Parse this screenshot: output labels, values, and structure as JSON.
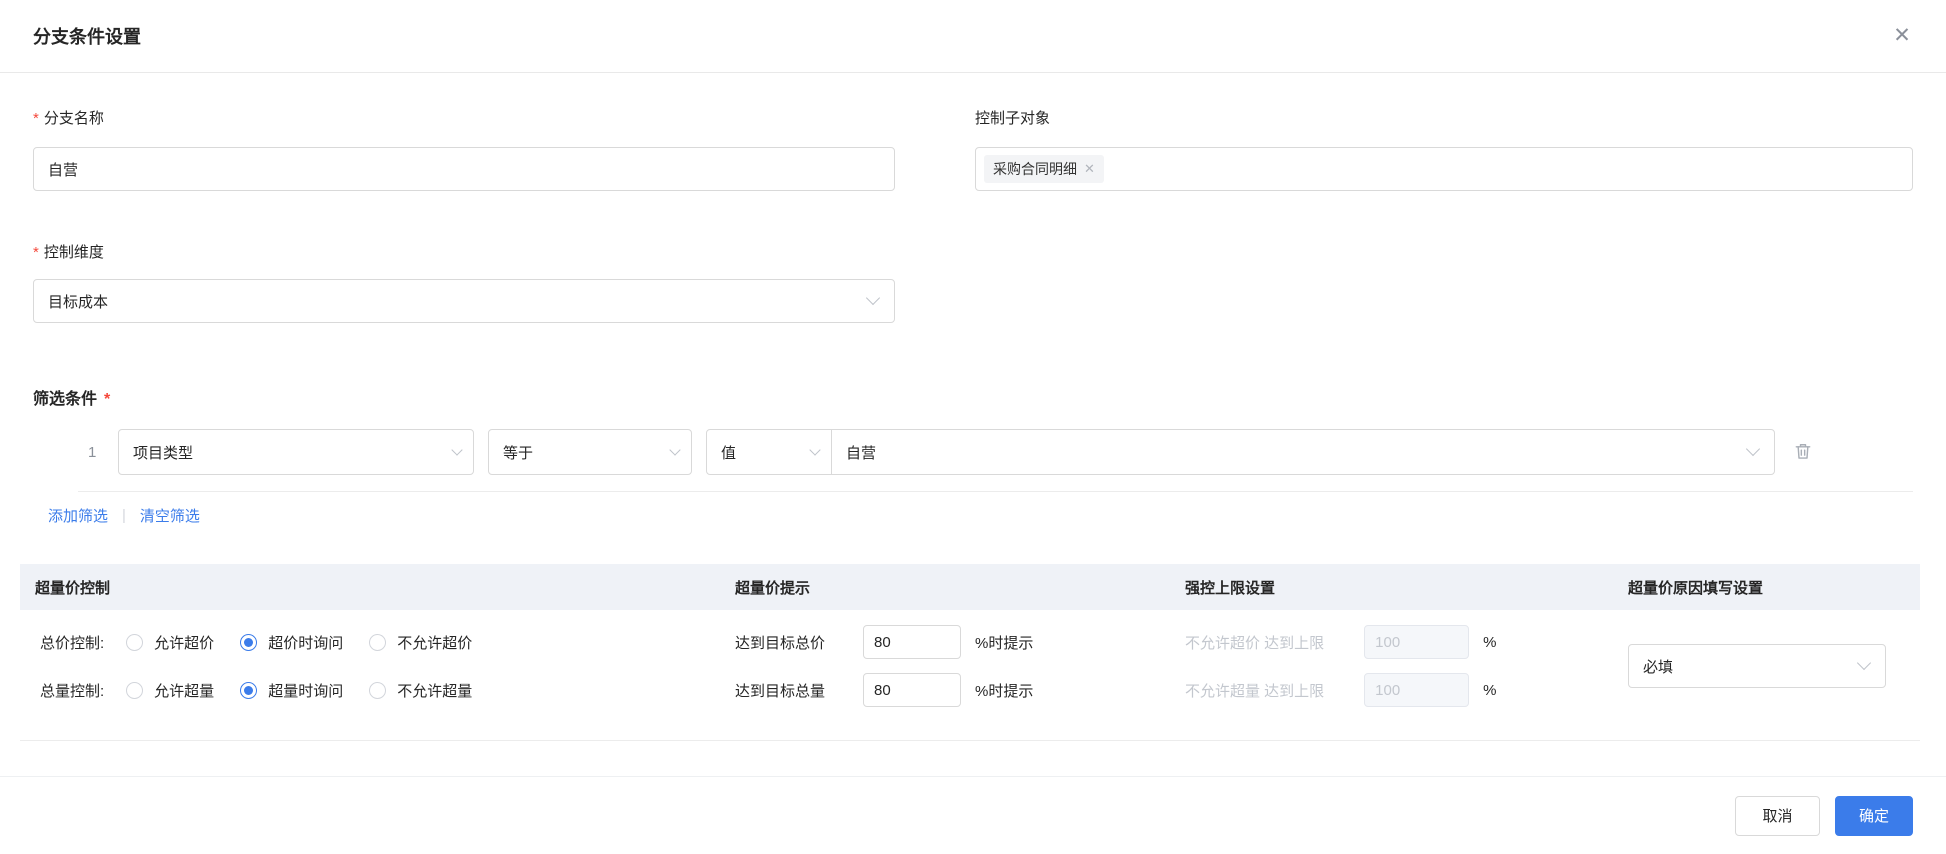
{
  "colors": {
    "primary": "#3B7CEA",
    "required_mark": "#F5483B",
    "table_header_bg": "#EFF2F7",
    "disabled_text": "#C3C7CE",
    "link": "#3B7CEA"
  },
  "dialog": {
    "title": "分支条件设置",
    "close_glyph": "✕"
  },
  "form": {
    "branch_name": {
      "required_mark": "*",
      "label": "分支名称",
      "value": "自营"
    },
    "control_sub_object": {
      "label": "控制子对象",
      "tag": "采购合同明细",
      "tag_remove_glyph": "✕"
    },
    "control_dimension": {
      "required_mark": "*",
      "label": "控制维度",
      "value": "目标成本"
    }
  },
  "filter": {
    "title": "筛选条件",
    "required_mark": "*",
    "rows": [
      {
        "index": "1",
        "field": "项目类型",
        "operator": "等于",
        "value_type": "值",
        "value": "自营"
      }
    ],
    "add_label": "添加筛选",
    "separator": "|",
    "clear_label": "清空筛选"
  },
  "control_table": {
    "headers": [
      "超量价控制",
      "超量价提示",
      "强控上限设置",
      "超量价原因填写设置"
    ],
    "rows": [
      {
        "label": "总价控制:",
        "radios": [
          {
            "label": "允许超价",
            "checked": false
          },
          {
            "label": "超价时询问",
            "checked": true
          },
          {
            "label": "不允许超价",
            "checked": false
          }
        ],
        "prompt_prefix": "达到目标总价",
        "prompt_value": "80",
        "prompt_suffix": "%时提示",
        "limit_label": "不允许超价 达到上限",
        "limit_value": "100",
        "limit_unit": "%"
      },
      {
        "label": "总量控制:",
        "radios": [
          {
            "label": "允许超量",
            "checked": false
          },
          {
            "label": "超量时询问",
            "checked": true
          },
          {
            "label": "不允许超量",
            "checked": false
          }
        ],
        "prompt_prefix": "达到目标总量",
        "prompt_value": "80",
        "prompt_suffix": "%时提示",
        "limit_label": "不允许超量 达到上限",
        "limit_value": "100",
        "limit_unit": "%"
      }
    ],
    "reason_value": "必填"
  },
  "footer": {
    "cancel_label": "取消",
    "confirm_label": "确定"
  }
}
